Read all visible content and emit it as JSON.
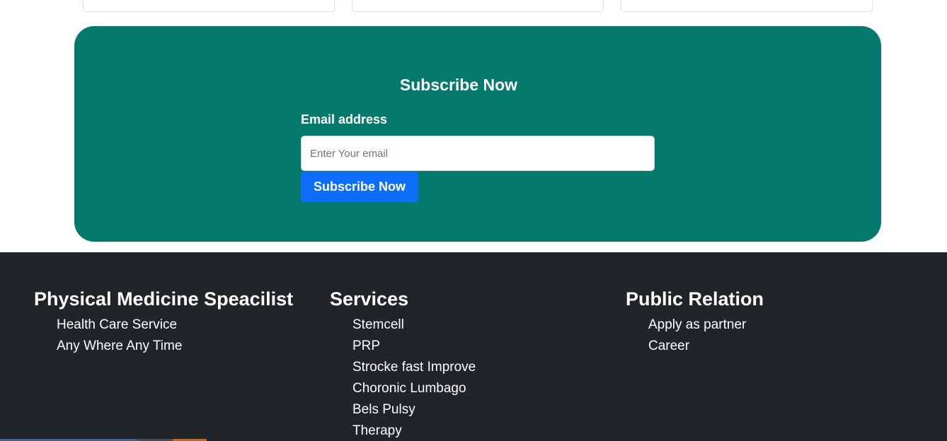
{
  "subscribe": {
    "title": "Subscribe Now",
    "email_label": "Email address",
    "email_placeholder": "Enter Your email",
    "email_value": "",
    "button_label": "Subscribe Now"
  },
  "footer": {
    "columns": [
      {
        "heading": "Physical Medicine Speacilist",
        "items": [
          "Health Care Service",
          "Any Where Any Time"
        ]
      },
      {
        "heading": "Services",
        "items": [
          "Stemcell",
          "PRP",
          "Strocke fast Improve",
          "Choronic Lumbago",
          "Bels Pulsy",
          "Therapy"
        ]
      },
      {
        "heading": "Public Relation",
        "items": [
          "Apply as partner",
          "Career"
        ]
      }
    ]
  },
  "colors": {
    "subscribe_bg": "#04796c",
    "footer_bg": "#212529",
    "button_bg": "#0d6efd"
  }
}
